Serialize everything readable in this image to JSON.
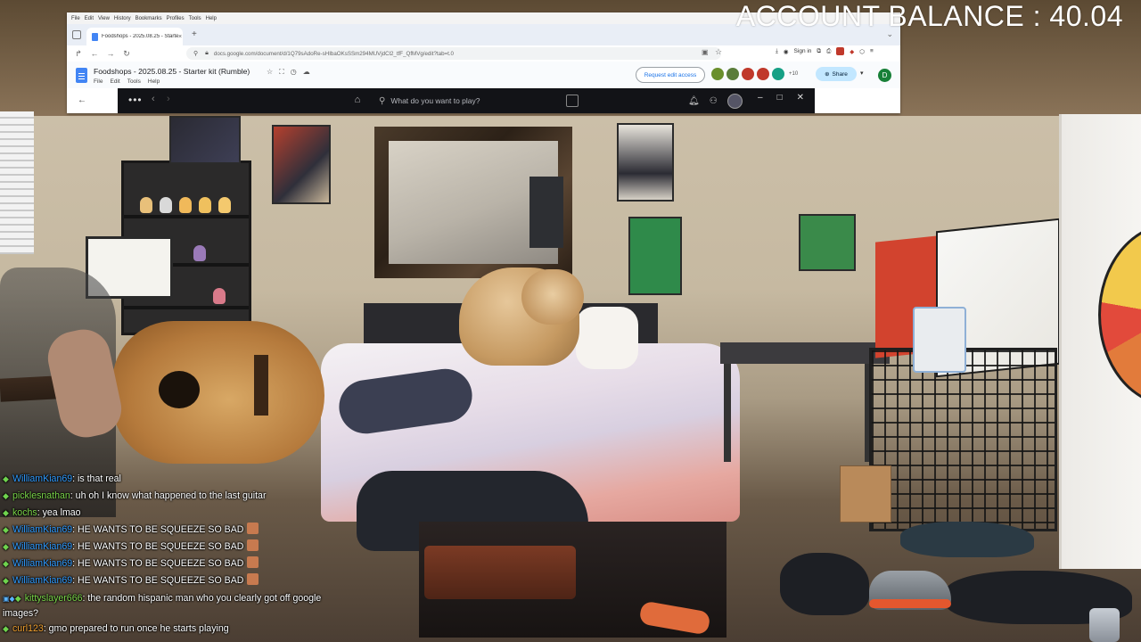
{
  "overlay": {
    "balance_text": "ACCOUNT BALANCE : 40.04"
  },
  "browser": {
    "menu": [
      "File",
      "Edit",
      "View",
      "History",
      "Bookmarks",
      "Profiles",
      "Tools",
      "Help"
    ],
    "tab_title": "Foodshops - 2025.08.25 - Starte",
    "tab_close": "×",
    "new_tab": "+",
    "url": "docs.google.com/document/d/1Q79sAdoRe-sHIbaOKsSSm294MUVjdCl2_tfF_QfMVg/edit?tab=t.0",
    "sign_in": "Sign in"
  },
  "docs": {
    "title": "Foodshops - 2025.08.25 - Starter kit (Rumble)",
    "menu": [
      "File",
      "Edit",
      "Tools",
      "Help"
    ],
    "request_edit": "Request edit access",
    "more_count": "+10",
    "share": "Share",
    "user_initial": "D",
    "avatar_colors": [
      "#6a8f2c",
      "#5a7d3a",
      "#c0392b",
      "#c0392b",
      "#16a085"
    ]
  },
  "launcher": {
    "search_placeholder": "What do you want to play?"
  },
  "chat": {
    "colors": {
      "blue": "#2f9bff",
      "green": "#7bd64a",
      "orange": "#f0a030",
      "text": "#ffffff"
    },
    "messages": [
      {
        "user": "WilliamKian69",
        "color": "blue",
        "text": ": is that real",
        "emote": false
      },
      {
        "user": "picklesnathan",
        "color": "green",
        "text": ": uh oh I know what happened to the last guitar",
        "emote": false
      },
      {
        "user": "kochs",
        "color": "green",
        "text": ": yea lmao",
        "emote": false
      },
      {
        "user": "WilliamKian69",
        "color": "blue",
        "text": ": HE WANTS TO BE SQUEEZE SO BAD",
        "emote": true
      },
      {
        "user": "WilliamKian69",
        "color": "blue",
        "text": ": HE WANTS TO BE SQUEEZE SO BAD",
        "emote": true
      },
      {
        "user": "WilliamKian69",
        "color": "blue",
        "text": ": HE WANTS TO BE SQUEEZE SO BAD",
        "emote": true
      },
      {
        "user": "WilliamKian69",
        "color": "blue",
        "text": ": HE WANTS TO BE SQUEEZE SO BAD",
        "emote": true
      },
      {
        "user": "kittyslayer666",
        "color": "green",
        "text": ": the random hispanic man who you clearly got off google images?",
        "emote": false,
        "badges": true
      },
      {
        "user": "curl123",
        "color": "orange",
        "text": ": gmo prepared to run once he starts playing",
        "emote": false
      }
    ]
  }
}
